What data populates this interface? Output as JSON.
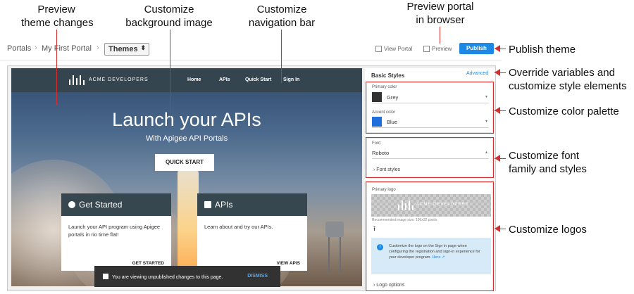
{
  "annotations": {
    "preview_theme": [
      "Preview",
      "theme changes"
    ],
    "customize_bg": [
      "Customize",
      "background image"
    ],
    "customize_nav": [
      "Customize",
      "navigation bar"
    ],
    "preview_portal": [
      "Preview portal",
      "in browser"
    ],
    "publish_theme": "Publish theme",
    "override_vars": [
      "Override variables and",
      "customize style elements"
    ],
    "customize_palette": "Customize color palette",
    "customize_font": [
      "Customize font",
      "family and styles"
    ],
    "customize_logos": "Customize logos"
  },
  "breadcrumb": {
    "root": "Portals",
    "portal": "My First Portal",
    "section": "Themes"
  },
  "toolbar": {
    "view_portal": "View Portal",
    "preview": "Preview",
    "publish": "Publish"
  },
  "portal": {
    "logo_text": "ACME DEVELOPERS",
    "nav": [
      "Home",
      "APIs",
      "Quick Start",
      "Sign In"
    ],
    "hero_title": "Launch your APIs",
    "hero_subtitle": "With Apigee API Portals",
    "quick_start": "QUICK START",
    "cards": [
      {
        "title": "Get Started",
        "body": "Launch your API program using Apigee portals in no time flat!",
        "cta": "GET STARTED",
        "icon": "check-circle-icon"
      },
      {
        "title": "APIs",
        "body": "Learn about and try our APIs.",
        "cta": "VIEW APIS",
        "icon": "book-icon"
      }
    ],
    "toast": {
      "text": "You are viewing unpublished changes to this page.",
      "action": "DISMISS"
    }
  },
  "panel": {
    "title": "Basic Styles",
    "advanced": "Advanced",
    "primary_color": {
      "label": "Primary color",
      "value": "Grey",
      "swatch": "#333333"
    },
    "accent_color": {
      "label": "Accent color",
      "value": "Blue",
      "swatch": "#1e6fd9"
    },
    "font": {
      "label": "Font",
      "value": "Roboto"
    },
    "font_styles": "Font styles",
    "primary_logo": {
      "label": "Primary logo",
      "preview_text": "ACME DEVELOPERS",
      "hint": "Recommended image size: 196x32 pixels"
    },
    "info": {
      "text": "Customize the logo on the Sign in page when configuring the registration and sign-in experience for your developer program.",
      "link": "Here"
    },
    "logo_options": "Logo options"
  },
  "colors": {
    "accent": "#1e88e5",
    "callout": "#d32f2f",
    "nav_bg": "#35454f"
  }
}
